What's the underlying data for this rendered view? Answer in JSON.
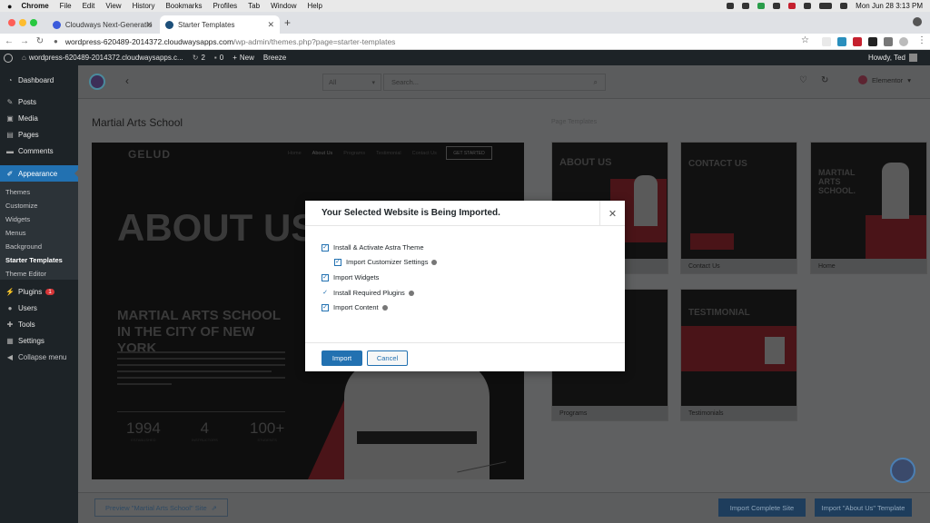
{
  "mac_menu": {
    "app": "Chrome",
    "items": [
      "File",
      "Edit",
      "View",
      "History",
      "Bookmarks",
      "Profiles",
      "Tab",
      "Window",
      "Help"
    ],
    "clock": "Mon Jun 28  3:13 PM"
  },
  "browser": {
    "tabs": [
      {
        "title": "Cloudways Next-Generation Cl",
        "active": false
      },
      {
        "title": "Starter Templates",
        "active": true
      }
    ],
    "url_host": "wordpress-620489-2014372.cloudwaysapps.com",
    "url_path": "/wp-admin/themes.php?page=starter-templates"
  },
  "wp_adminbar": {
    "site": "wordpress-620489-2014372.cloudwaysapps.c...",
    "updates": "2",
    "comments": "0",
    "new": "New",
    "breeze": "Breeze",
    "greeting": "Howdy, Ted"
  },
  "sidebar": {
    "items": [
      {
        "label": "Dashboard",
        "icon": "dashboard-icon"
      },
      {
        "label": "Posts",
        "icon": "pin-icon"
      },
      {
        "label": "Media",
        "icon": "media-icon"
      },
      {
        "label": "Pages",
        "icon": "page-icon"
      },
      {
        "label": "Comments",
        "icon": "comment-icon"
      },
      {
        "label": "Appearance",
        "icon": "brush-icon"
      },
      {
        "label": "Plugins",
        "icon": "plug-icon",
        "badge": "1"
      },
      {
        "label": "Users",
        "icon": "user-icon"
      },
      {
        "label": "Tools",
        "icon": "wrench-icon"
      },
      {
        "label": "Settings",
        "icon": "settings-icon"
      },
      {
        "label": "Collapse menu",
        "icon": "collapse-icon"
      }
    ],
    "appearance_sub": [
      "Themes",
      "Customize",
      "Widgets",
      "Menus",
      "Background",
      "Starter Templates",
      "Theme Editor"
    ]
  },
  "starter": {
    "filter_value": "All",
    "search_placeholder": "Search...",
    "builder": "Elementor",
    "site_title": "Martial Arts School",
    "page_templates_heading": "Page Templates",
    "preview": {
      "logo": "GELUD",
      "nav": [
        "Home",
        "About Us",
        "Programs",
        "Testimonial",
        "Contact Us"
      ],
      "cta": "GET STARTED",
      "hero": "ABOUT US",
      "headline": "MARTIAL ARTS SCHOOL IN THE CITY OF NEW YORK",
      "stats": [
        {
          "value": "1994",
          "label": "ESTABLISHED"
        },
        {
          "value": "4",
          "label": "INSTRUCTORS"
        },
        {
          "value": "100+",
          "label": "STUDENTS"
        }
      ]
    },
    "templates": [
      {
        "name": "",
        "thumb": "ABOUT US"
      },
      {
        "name": "Contact Us",
        "thumb": "CONTACT US"
      },
      {
        "name": "Home",
        "thumb": "MARTIAL ARTS SCHOOL."
      },
      {
        "name": "Programs",
        "thumb": ""
      },
      {
        "name": "Testimonials",
        "thumb": "TESTIMONIAL"
      }
    ],
    "preview_button": "Preview \"Martial Arts School\" Site",
    "import_complete": "Import Complete Site",
    "import_about": "Import \"About Us\" Template"
  },
  "modal": {
    "title": "Your Selected Website is Being Imported.",
    "options": [
      {
        "label": "Install & Activate Astra Theme",
        "checked": true,
        "help": false
      },
      {
        "label": "Import Customizer Settings",
        "checked": true,
        "help": true
      },
      {
        "label": "Import Widgets",
        "checked": true,
        "help": false
      },
      {
        "label": "Install Required Plugins",
        "checked": true,
        "help": true
      },
      {
        "label": "Import Content",
        "checked": true,
        "help": true
      }
    ],
    "import_label": "Import",
    "cancel_label": "Cancel"
  },
  "colors": {
    "wp_blue": "#2271b1",
    "accent_red": "#c5202e",
    "admin_dark": "#1d2327"
  }
}
